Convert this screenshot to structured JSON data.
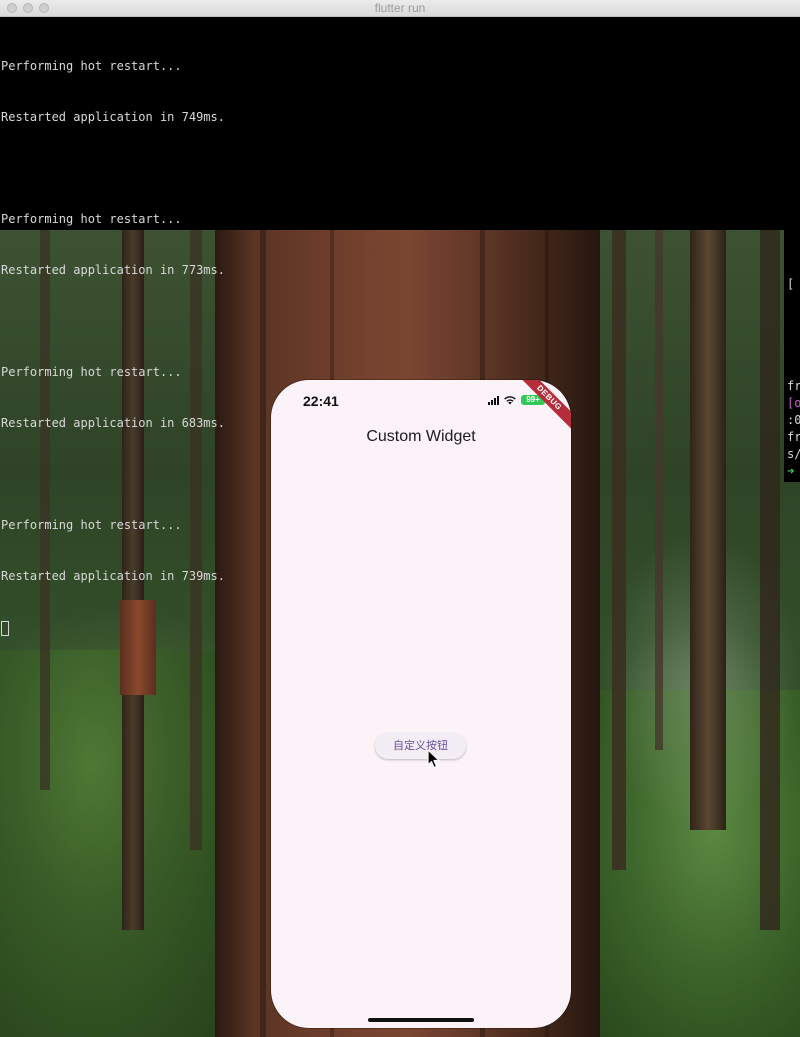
{
  "terminal": {
    "title": "flutter run",
    "lines": [
      "Performing hot restart...",
      "Restarted application in 749ms.",
      "",
      "Performing hot restart...",
      "Restarted application in 773ms.",
      "",
      "Performing hot restart...",
      "Restarted application in 683ms.",
      "",
      "Performing hot restart...",
      "Restarted application in 739ms."
    ]
  },
  "side_terminal": {
    "lines": [
      "[",
      "fr",
      "[o",
      ":0",
      "fr",
      "s/",
      "➜"
    ]
  },
  "phone": {
    "status": {
      "time": "22:41",
      "battery": "99+"
    },
    "debug_banner": "DEBUG",
    "app_title": "Custom Widget",
    "custom_button_label": "自定义按钮"
  },
  "colors": {
    "terminal_bg": "#000000",
    "terminal_text": "#d8d8d8",
    "phone_bg": "#fbf3f8",
    "button_text": "#6750a4",
    "debug_banner": "#b52d3a",
    "battery": "#34c759"
  }
}
